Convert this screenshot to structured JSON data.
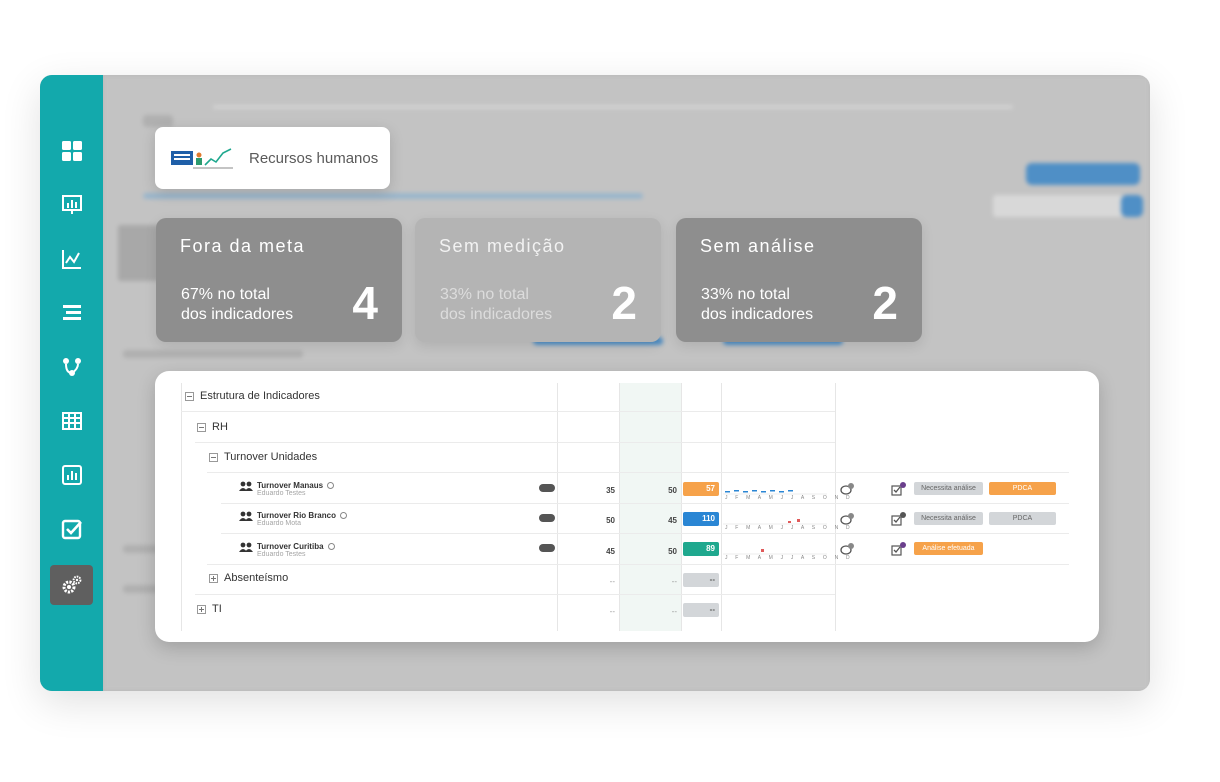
{
  "title_card": {
    "title": "Recursos humanos"
  },
  "kpis": [
    {
      "title": "Fora da meta",
      "sub1": "67% no total",
      "sub2": "dos indicadores",
      "value": "4"
    },
    {
      "title": "Sem medição",
      "sub1": "33% no total",
      "sub2": "dos indicadores",
      "value": "2"
    },
    {
      "title": "Sem análise",
      "sub1": "33% no total",
      "sub2": "dos indicadores",
      "value": "2"
    }
  ],
  "tree": {
    "root": "Estrutura de Indicadores",
    "group_rh": "RH",
    "group_turnover": "Turnover Unidades",
    "group_absenteismo": "Absenteísmo",
    "group_ti": "TI",
    "dash": "--",
    "months": "J F M A M J J A S O N D",
    "indicators": [
      {
        "name": "Turnover Manaus",
        "owner": "Eduardo Testes",
        "goal": "35",
        "prev": "50",
        "value": "57",
        "color": "#f6a24a",
        "status1": "Necessita análise",
        "status2": "PDCA"
      },
      {
        "name": "Turnover Rio Branco",
        "owner": "Eduardo Mota",
        "goal": "50",
        "prev": "45",
        "value": "110",
        "color": "#2a86d4",
        "status1": "Necessita análise",
        "status2": "PDCA"
      },
      {
        "name": "Turnover Curitiba",
        "owner": "Eduardo Testes",
        "goal": "45",
        "prev": "50",
        "value": "89",
        "color": "#1fa88e",
        "status1": "Análise efetuada",
        "status2": ""
      }
    ]
  },
  "sidebar": {
    "items": [
      "dashboard-icon",
      "presentation-icon",
      "line-chart-icon",
      "list-icon",
      "flow-icon",
      "table-icon",
      "bar-chart-icon",
      "checkbox-icon",
      "settings-icon"
    ]
  }
}
